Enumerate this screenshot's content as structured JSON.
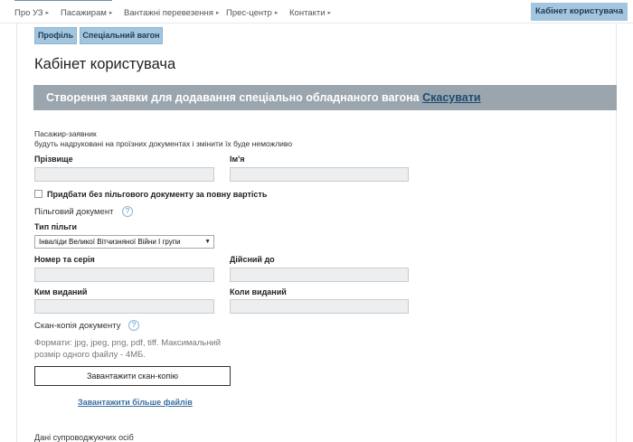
{
  "nav": {
    "items": [
      {
        "label": "Про УЗ"
      },
      {
        "label": "Пасажирам"
      },
      {
        "label": "Вантажні перевезення"
      },
      {
        "label": "Прес-центр"
      },
      {
        "label": "Контакти"
      }
    ],
    "arrow": "▸",
    "cabinet_button": "Кабінет користувача"
  },
  "tabs": {
    "profile": "Профіль",
    "special_car": "Спеціальний вагон"
  },
  "page_title": "Кабінет користувача",
  "banner": {
    "text": "Створення заявки для додавання спеціально обладнаного вагона",
    "cancel_link": "Скасувати",
    "color": "#9aa5ad"
  },
  "form": {
    "applicant_heading": "Пасажир-заявник",
    "applicant_note": "будуть надруковані на проїзних документах і змінити їх буде неможливо",
    "surname_label": "Прізвище",
    "surname_value": "",
    "name_label": "Ім'я",
    "name_value": "",
    "no_privilege_checkbox": "Придбати без пільгового документу за повну вартість",
    "privilege_doc_label": "Пільговий документ",
    "privilege_type_label": "Тип пільги",
    "privilege_type_value": "Інваліди Великої Вітчизняної Війни I групи",
    "number_series_label": "Номер та серія",
    "valid_until_label": "Дійсний до",
    "issued_by_label": "Ким виданий",
    "issued_date_label": "Коли виданий",
    "scan_label": "Скан-копія документу",
    "formats_note": "Формати: jpg, jpeg, png, pdf, tiff. Максимальний розмір одного файлу - 4МБ.",
    "upload_button": "Завантажити скан-копію",
    "upload_more_link": "Завантажити більше файлів",
    "companions_heading": "Дані супроводжуючих осіб"
  },
  "icons": {
    "help": "?",
    "caret": "▼"
  },
  "colors": {
    "accent": "#a3c5de",
    "link": "#3a6fa0"
  }
}
